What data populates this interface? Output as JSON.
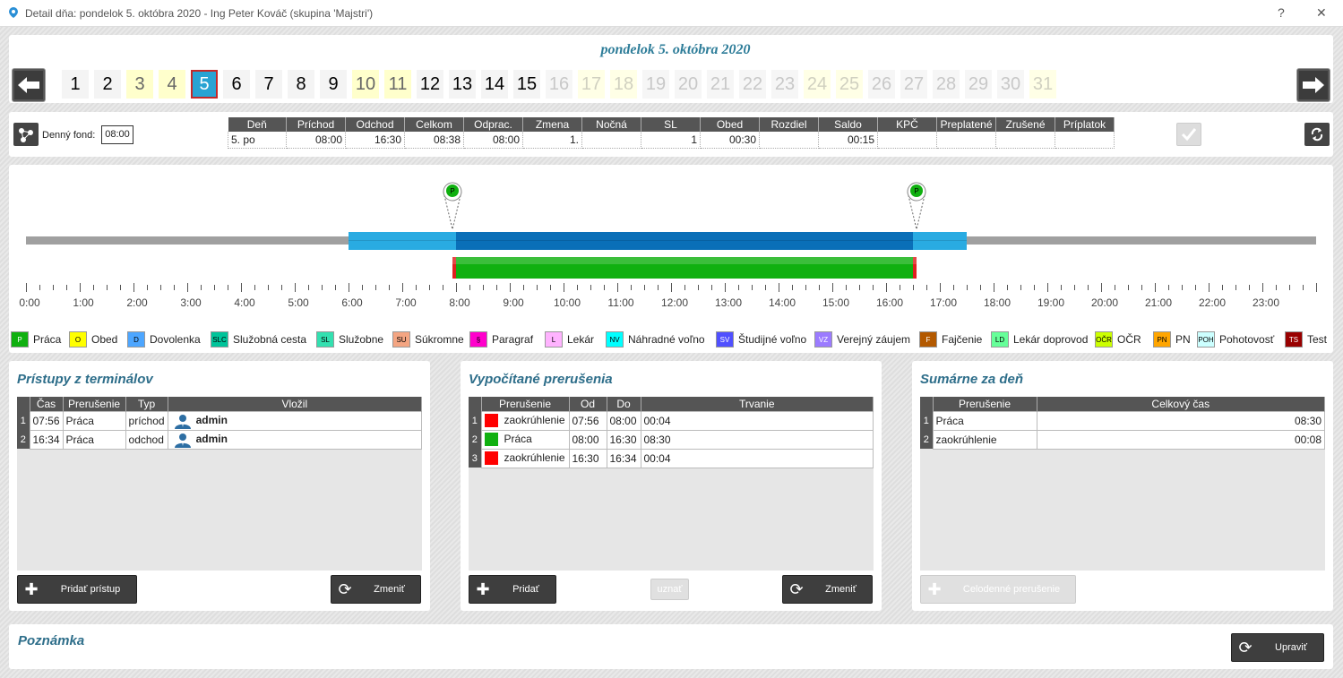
{
  "window": {
    "title": "Detail dňa: pondelok 5. októbra 2020 - Ing Peter Kováč  (skupina 'Majstri')",
    "help": "?",
    "close": "✕"
  },
  "date_title": "pondelok 5. októbra 2020",
  "days": [
    {
      "n": "1",
      "t": "work"
    },
    {
      "n": "2",
      "t": "work"
    },
    {
      "n": "3",
      "t": "weekend"
    },
    {
      "n": "4",
      "t": "weekend"
    },
    {
      "n": "5",
      "t": "selected"
    },
    {
      "n": "6",
      "t": "work"
    },
    {
      "n": "7",
      "t": "work"
    },
    {
      "n": "8",
      "t": "work"
    },
    {
      "n": "9",
      "t": "work"
    },
    {
      "n": "10",
      "t": "weekend"
    },
    {
      "n": "11",
      "t": "weekend"
    },
    {
      "n": "12",
      "t": "work"
    },
    {
      "n": "13",
      "t": "work"
    },
    {
      "n": "14",
      "t": "work"
    },
    {
      "n": "15",
      "t": "work"
    },
    {
      "n": "16",
      "t": "future"
    },
    {
      "n": "17",
      "t": "future-weekend"
    },
    {
      "n": "18",
      "t": "future-weekend"
    },
    {
      "n": "19",
      "t": "future"
    },
    {
      "n": "20",
      "t": "future"
    },
    {
      "n": "21",
      "t": "future"
    },
    {
      "n": "22",
      "t": "future"
    },
    {
      "n": "23",
      "t": "future"
    },
    {
      "n": "24",
      "t": "future-weekend"
    },
    {
      "n": "25",
      "t": "future-weekend"
    },
    {
      "n": "26",
      "t": "future"
    },
    {
      "n": "27",
      "t": "future"
    },
    {
      "n": "28",
      "t": "future"
    },
    {
      "n": "29",
      "t": "future"
    },
    {
      "n": "30",
      "t": "future"
    },
    {
      "n": "31",
      "t": "future-weekend"
    }
  ],
  "fund": {
    "label": "Denný fond:",
    "value": "08:00"
  },
  "summary": {
    "headers": [
      "Deň",
      "Príchod",
      "Odchod",
      "Celkom",
      "Odprac.",
      "Zmena",
      "Nočná",
      "SL",
      "Obed",
      "Rozdiel",
      "Saldo",
      "KPČ",
      "Preplatené",
      "Zrušené",
      "Príplatok"
    ],
    "row": [
      "5. po",
      "08:00",
      "16:30",
      "08:38",
      "08:00",
      "1.",
      "",
      "1",
      "00:30",
      "",
      "00:15",
      "",
      "",
      "",
      ""
    ]
  },
  "timeline": {
    "hours": [
      "0:00",
      "1:00",
      "2:00",
      "3:00",
      "4:00",
      "5:00",
      "6:00",
      "7:00",
      "8:00",
      "9:00",
      "10:00",
      "11:00",
      "12:00",
      "13:00",
      "14:00",
      "15:00",
      "16:00",
      "17:00",
      "18:00",
      "19:00",
      "20:00",
      "21:00",
      "22:00",
      "23:00"
    ],
    "shift_light": [
      "06:00",
      "17:30"
    ],
    "shift_core": [
      "08:00",
      "16:30"
    ],
    "work_bar": [
      "07:56",
      "16:34"
    ],
    "markers": [
      {
        "time": "07:56",
        "label": "P"
      },
      {
        "time": "16:34",
        "label": "P"
      }
    ],
    "colors": {
      "light": "#29abe2",
      "core": "#0a6fb8",
      "work": "#10b010",
      "round": "#e02020"
    }
  },
  "legend": [
    {
      "code": "P",
      "label": "Práca",
      "color": "#10b010",
      "fg": "#fff"
    },
    {
      "code": "O",
      "label": "Obed",
      "color": "#ffff00",
      "fg": "#000"
    },
    {
      "code": "D",
      "label": "Dovolenka",
      "color": "#4da6ff",
      "fg": "#000"
    },
    {
      "code": "SLC",
      "label": "Služobná cesta",
      "color": "#00c49a",
      "fg": "#000"
    },
    {
      "code": "SL",
      "label": "Služobne",
      "color": "#33e0b0",
      "fg": "#000"
    },
    {
      "code": "SU",
      "label": "Súkromne",
      "color": "#f4a582",
      "fg": "#000"
    },
    {
      "code": "§",
      "label": "Paragraf",
      "color": "#ff00cc",
      "fg": "#000"
    },
    {
      "code": "L",
      "label": "Lekár",
      "color": "#ffb3ff",
      "fg": "#000"
    },
    {
      "code": "NV",
      "label": "Náhradné voľno",
      "color": "#00ffff",
      "fg": "#000"
    },
    {
      "code": "SV",
      "label": "Študijné voľno",
      "color": "#5050ff",
      "fg": "#fff"
    },
    {
      "code": "VZ",
      "label": "Verejný záujem",
      "color": "#9b7bff",
      "fg": "#fff"
    },
    {
      "code": "F",
      "label": "Fajčenie",
      "color": "#b35900",
      "fg": "#fff"
    },
    {
      "code": "LD",
      "label": "Lekár doprovod",
      "color": "#66ff99",
      "fg": "#000"
    },
    {
      "code": "OČR",
      "label": "OČR",
      "color": "#ccff00",
      "fg": "#000"
    },
    {
      "code": "PN",
      "label": "PN",
      "color": "#ffa500",
      "fg": "#000"
    },
    {
      "code": "POH",
      "label": "Pohotovosť",
      "color": "#ccffff",
      "fg": "#000"
    },
    {
      "code": "TS",
      "label": "Test",
      "color": "#990000",
      "fg": "#fff"
    }
  ],
  "terminals": {
    "title": "Prístupy z terminálov",
    "headers": [
      "Čas",
      "Prerušenie",
      "Typ",
      "Vložil"
    ],
    "rows": [
      {
        "n": "1",
        "time": "07:56",
        "type": "Práca",
        "dir": "príchod",
        "user": "admin"
      },
      {
        "n": "2",
        "time": "16:34",
        "type": "Práca",
        "dir": "odchod",
        "user": "admin"
      }
    ],
    "add_btn": "Pridať prístup",
    "change_btn": "Zmeniť"
  },
  "computed": {
    "title": "Vypočítané prerušenia",
    "headers": [
      "Prerušenie",
      "Od",
      "Do",
      "Trvanie"
    ],
    "rows": [
      {
        "n": "1",
        "color": "#ff0000",
        "name": "zaokrúhlenie",
        "from": "07:56",
        "to": "08:00",
        "dur": "00:04"
      },
      {
        "n": "2",
        "color": "#10b010",
        "name": "Práca",
        "from": "08:00",
        "to": "16:30",
        "dur": "08:30"
      },
      {
        "n": "3",
        "color": "#ff0000",
        "name": "zaokrúhlenie",
        "from": "16:30",
        "to": "16:34",
        "dur": "00:04"
      }
    ],
    "add_btn": "Pridať",
    "accept_btn": "uznať",
    "change_btn": "Zmeniť"
  },
  "daysum": {
    "title": "Sumárne za deň",
    "headers": [
      "Prerušenie",
      "Celkový čas"
    ],
    "rows": [
      {
        "n": "1",
        "name": "Práca",
        "total": "08:30"
      },
      {
        "n": "2",
        "name": "zaokrúhlenie",
        "total": "00:08"
      }
    ],
    "whole_day_btn": "Celodenné prerušenie"
  },
  "note": {
    "title": "Poznámka",
    "edit_btn": "Upraviť"
  }
}
